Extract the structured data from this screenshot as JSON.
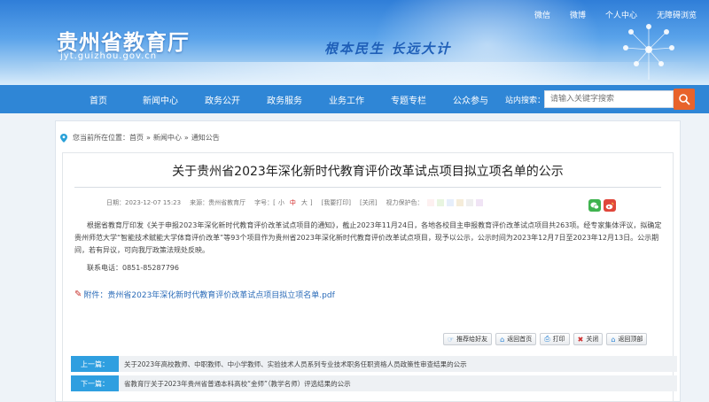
{
  "header": {
    "site_title": "贵州省教育厅",
    "site_domain": "jyt.guizhou.gov.cn",
    "slogan": "根本民生 长远大计",
    "top_links": [
      "微信",
      "微博",
      "个人中心",
      "无障碍浏览"
    ]
  },
  "nav": {
    "items": [
      "首页",
      "新闻中心",
      "政务公开",
      "政务服务",
      "业务工作",
      "专题专栏",
      "公众参与"
    ],
    "search_label": "站内搜索：",
    "search_placeholder": "请输入关键字搜索"
  },
  "breadcrumb": {
    "prefix": "您当前所在位置：",
    "items": [
      "首页",
      "新闻中心",
      "通知公告"
    ],
    "separator": "»"
  },
  "article": {
    "title": "关于贵州省2023年深化新时代教育评价改革试点项目拟立项名单的公示",
    "meta": {
      "date": "日期：2023-12-07 15:23",
      "source": "来源：贵州省教育厅",
      "font_size_label": "字号：[",
      "size_small": "小",
      "size_mid": "中",
      "size_large": "大",
      "size_close": "]",
      "print": "[我要打印]",
      "close": "[关闭]",
      "eye_label": "视力保护色：",
      "swatch_colors": [
        "#fdf0f0",
        "#e8f5e0",
        "#e6eefb",
        "#f5ecd9",
        "#eeeeee",
        "#f0e4f5"
      ]
    },
    "paragraph": "根据省教育厅印发《关于申报2023年深化新时代教育评价改革试点项目的通知》，截止2023年11月24日，各地各校目主申报教育评价改革试点项目共263项。经专家集体评议，拟确定贵州师范大学“智能技术赋能大学体育评价改革”等93个项目作为贵州省2023年深化新时代教育评价改革试点项目，现予以公示，公示时间为2023年12月7日至2023年12月13日。公示期间，若有异议，可向我厅政策法规处反映。",
    "contact": "联系电话：0851-85287796",
    "attachment": "附件：贵州省2023年深化新时代教育评价改革试点项目拟立项名单.pdf"
  },
  "tools": {
    "share": "推荐给好友",
    "home": "返回首页",
    "print": "打印",
    "close": "关闭",
    "top": "返回顶部"
  },
  "prevnext": {
    "prev_label": "上一篇：",
    "prev_text": "关于2023年高校教师、中职教师、中小学教师、实验技术人员系列专业技术职务任职资格人员政策性审查结果的公示",
    "next_label": "下一篇：",
    "next_text": "省教育厅关于2023年贵州省普通本科高校“金师”（教学名师）评选结果的公示"
  },
  "colors": {
    "nav_blue": "#2f86d6",
    "search_orange": "#e8632b",
    "label_blue": "#2f9fe0"
  }
}
